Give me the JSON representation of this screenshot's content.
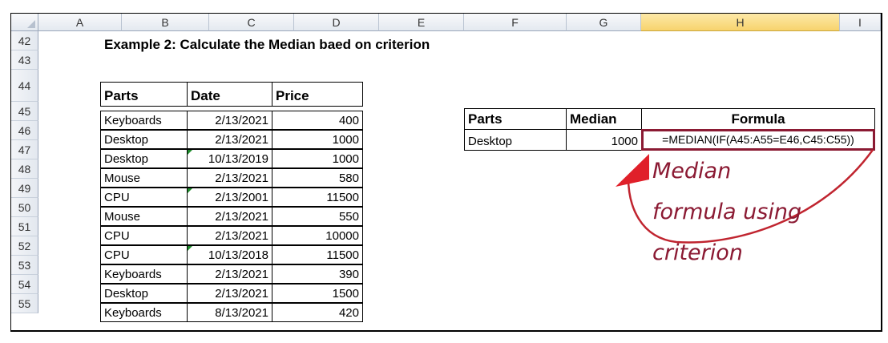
{
  "columns": [
    "A",
    "B",
    "C",
    "D",
    "E",
    "F",
    "G",
    "H",
    "I"
  ],
  "selected_column": "H",
  "rows": [
    "42",
    "43",
    "44",
    "45",
    "46",
    "47",
    "48",
    "49",
    "50",
    "51",
    "52",
    "53",
    "54",
    "55"
  ],
  "title": "Example 2: Calculate the Median baed on criterion",
  "table1": {
    "headers": [
      "Parts",
      "Date",
      "Price"
    ],
    "rows": [
      [
        "Keyboards",
        "2/13/2021",
        "400"
      ],
      [
        "Desktop",
        "2/13/2021",
        "1000"
      ],
      [
        "Desktop",
        "10/13/2019",
        "1000"
      ],
      [
        "Mouse",
        "2/13/2021",
        "580"
      ],
      [
        "CPU",
        "2/13/2001",
        "11500"
      ],
      [
        "Mouse",
        "2/13/2021",
        "550"
      ],
      [
        "CPU",
        "2/13/2021",
        "10000"
      ],
      [
        "CPU",
        "10/13/2018",
        "11500"
      ],
      [
        "Keyboards",
        "2/13/2021",
        "390"
      ],
      [
        "Desktop",
        "2/13/2021",
        "1500"
      ],
      [
        "Keyboards",
        "8/13/2021",
        "420"
      ]
    ]
  },
  "table2": {
    "headers": [
      "Parts",
      "Median",
      "Formula"
    ],
    "row": [
      "Desktop",
      "1000",
      "=MEDIAN(IF(A45:A55=E46,C45:C55))"
    ]
  },
  "annotation": {
    "line1": "Median",
    "line2": "formula  using",
    "line3": "criterion",
    "color": "#8b1a33"
  }
}
